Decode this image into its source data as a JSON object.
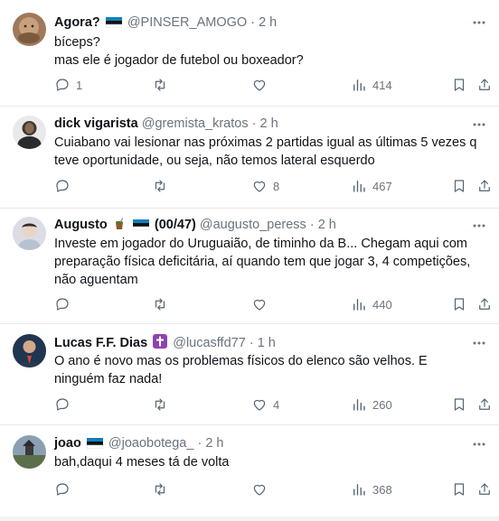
{
  "tweets": [
    {
      "name": "Agora?",
      "handle": "@PINSER_AMOGO",
      "sep": "·",
      "time": "2 h",
      "body": "bíceps?\nmas ele é jogador de futebol ou boxeador?",
      "replies": "1",
      "retweets": "",
      "likes": "",
      "views": "414",
      "avatar_color": "#a0785a"
    },
    {
      "name": "dick vigarista",
      "handle": "@gremista_kratos",
      "sep": "·",
      "time": "2 h",
      "body": "Cuiabano vai lesionar nas próximas 2 partidas igual as últimas 5 vezes q teve oportunidade, ou seja, não temos lateral esquerdo",
      "replies": "",
      "retweets": "",
      "likes": "8",
      "views": "467",
      "avatar_color": "#3a3a3a"
    },
    {
      "name": "Augusto",
      "badge": "(00/47)",
      "handle": "@augusto_peress",
      "sep": "·",
      "time": "2 h",
      "body": "Investe em jogador do Uruguaião, de timinho da B... Chegam aqui com preparação física deficitária, aí quando tem que jogar 3, 4 competições, não aguentam",
      "replies": "",
      "retweets": "",
      "likes": "",
      "views": "440",
      "avatar_color": "#cfcfd6"
    },
    {
      "name": "Lucas F.F. Dias",
      "handle": "@lucasffd77",
      "sep": "·",
      "time": "1 h",
      "body": "O ano é novo mas os problemas físicos do elenco são velhos. E ninguém faz nada!",
      "replies": "",
      "retweets": "",
      "likes": "4",
      "views": "260",
      "avatar_color": "#1f3550"
    },
    {
      "name": "joao",
      "handle": "@joaobotega_",
      "sep": "·",
      "time": "2 h",
      "body": "bah,daqui 4 meses tá de volta",
      "replies": "",
      "retweets": "",
      "likes": "",
      "views": "368",
      "avatar_color": "#5d6e4a"
    }
  ],
  "colors": {
    "text": "#0f1419",
    "muted": "#6a737c",
    "divider": "#e6e9ec",
    "gremio_blue": "#0d80bf",
    "cross_purple": "#8e44ad"
  },
  "icons": [
    "more-icon",
    "reply-icon",
    "retweet-icon",
    "like-icon",
    "views-icon",
    "bookmark-icon",
    "share-icon",
    "flag-emoji",
    "mate-emoji",
    "cross-emoji"
  ]
}
